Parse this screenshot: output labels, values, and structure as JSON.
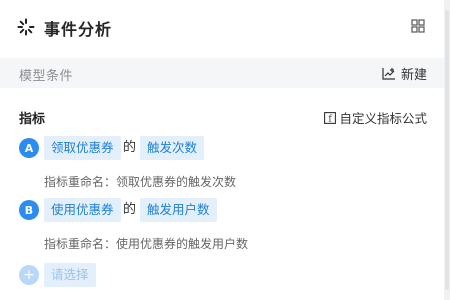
{
  "header": {
    "title": "事件分析",
    "icons": [
      "loading-spin-icon",
      "grid-view-icon"
    ]
  },
  "model_section": {
    "label": "模型条件",
    "new_button": "新建",
    "new_icon": "add-chart-icon"
  },
  "metrics": {
    "label": "指标",
    "formula_button": "自定义指标公式",
    "formula_icon": "formula-icon",
    "items": [
      {
        "badge": "A",
        "event": "领取优惠券",
        "connector": "的",
        "measure": "触发次数",
        "rename_label": "指标重命名：",
        "rename_value": "领取优惠券的触发次数"
      },
      {
        "badge": "B",
        "event": "使用优惠券",
        "connector": "的",
        "measure": "触发用户数",
        "rename_label": "指标重命名：",
        "rename_value": "使用优惠券的触发用户数"
      }
    ],
    "add": {
      "symbol": "+",
      "placeholder": "请选择"
    }
  },
  "colors": {
    "accent": "#2d8cf0",
    "chip_bg": "#e3f0fc",
    "chip_text": "#1f7fd6",
    "section_bg": "#f5f6f8"
  }
}
